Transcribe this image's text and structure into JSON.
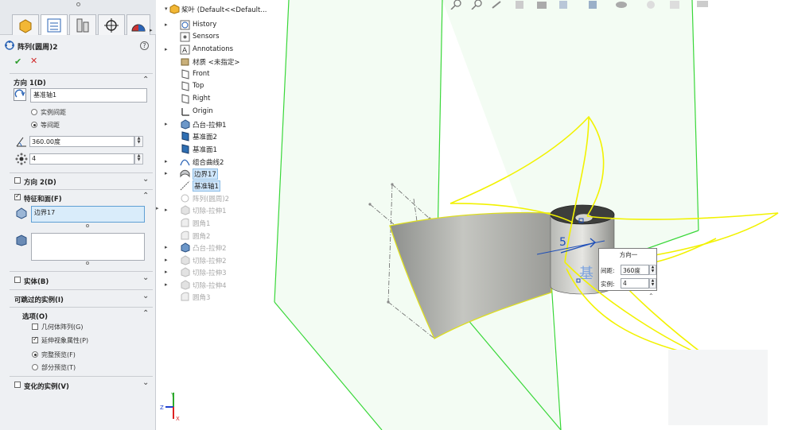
{
  "property_manager": {
    "title": "阵列(圆周)2",
    "help_icon": "question-mark-icon",
    "tabs": [
      "feature-manager-icon",
      "property-manager-icon",
      "configuration-manager-icon",
      "dimxpert-icon",
      "display-manager-icon"
    ],
    "direction1": {
      "label": "方向 1(D)",
      "axis_value": "基准轴1",
      "spacing_options": [
        {
          "label": "实例间距",
          "selected": false
        },
        {
          "label": "等间距",
          "selected": true
        }
      ],
      "angle_value": "360.00度",
      "instances_value": "4"
    },
    "direction2": {
      "label": "方向 2(D)",
      "checked": false
    },
    "features_faces": {
      "label": "特征和面(F)",
      "checked": true,
      "features_list": [
        "边界17"
      ],
      "faces_list": []
    },
    "bodies": {
      "label": "实体(B)",
      "checked": false
    },
    "skipped_instances": {
      "label": "可跳过的实例(I)"
    },
    "options": {
      "label": "选项(O)",
      "geometry_pattern": {
        "label": "几何体阵列(G)",
        "checked": false
      },
      "propagate_visual": {
        "label": "延伸视象属性(P)",
        "checked": true
      },
      "full_preview": {
        "label": "完整预览(F)",
        "selected": true
      },
      "partial_preview": {
        "label": "部分预览(T)",
        "selected": false
      }
    },
    "varying_instances": {
      "label": "变化的实例(V)",
      "checked": false
    }
  },
  "feature_tree": {
    "root": "桨叶  (Default<<Default...",
    "items": [
      {
        "label": "History",
        "icon": "history-icon",
        "expand": true,
        "state": "normal"
      },
      {
        "label": "Sensors",
        "icon": "sensors-icon",
        "expand": false,
        "state": "normal"
      },
      {
        "label": "Annotations",
        "icon": "annotations-icon",
        "expand": true,
        "state": "normal"
      },
      {
        "label": "材质 <未指定>",
        "icon": "material-icon",
        "expand": false,
        "state": "normal"
      },
      {
        "label": "Front",
        "icon": "plane-icon",
        "expand": false,
        "state": "normal"
      },
      {
        "label": "Top",
        "icon": "plane-icon",
        "expand": false,
        "state": "normal"
      },
      {
        "label": "Right",
        "icon": "plane-icon",
        "expand": false,
        "state": "normal"
      },
      {
        "label": "Origin",
        "icon": "origin-icon",
        "expand": false,
        "state": "normal"
      },
      {
        "label": "凸台-拉伸1",
        "icon": "boss-extrude-icon",
        "expand": true,
        "state": "normal"
      },
      {
        "label": "基准面2",
        "icon": "plane-solid-icon",
        "expand": false,
        "state": "normal"
      },
      {
        "label": "基准面1",
        "icon": "plane-solid-icon",
        "expand": false,
        "state": "normal"
      },
      {
        "label": "组合曲线2",
        "icon": "composite-curve-icon",
        "expand": true,
        "state": "normal"
      },
      {
        "label": "边界17",
        "icon": "boundary-icon",
        "expand": true,
        "state": "selected"
      },
      {
        "label": "基准轴1",
        "icon": "axis-icon",
        "expand": false,
        "state": "selected"
      },
      {
        "label": "阵列(圆周)2",
        "icon": "circular-pattern-icon",
        "expand": false,
        "state": "dim"
      },
      {
        "label": "切除-拉伸1",
        "icon": "cut-extrude-icon",
        "expand": true,
        "state": "dim"
      },
      {
        "label": "圆角1",
        "icon": "fillet-icon",
        "expand": false,
        "state": "dim"
      },
      {
        "label": "圆角2",
        "icon": "fillet-icon",
        "expand": false,
        "state": "dim"
      },
      {
        "label": "凸台-拉伸2",
        "icon": "boss-extrude-icon",
        "expand": true,
        "state": "dim"
      },
      {
        "label": "切除-拉伸2",
        "icon": "cut-extrude-icon",
        "expand": true,
        "state": "dim"
      },
      {
        "label": "切除-拉伸3",
        "icon": "cut-extrude-icon",
        "expand": true,
        "state": "dim"
      },
      {
        "label": "切除-拉伸4",
        "icon": "cut-extrude-icon",
        "expand": true,
        "state": "dim"
      },
      {
        "label": "圆角3",
        "icon": "fillet-icon",
        "expand": false,
        "state": "dim"
      }
    ]
  },
  "callout": {
    "title": "方向一",
    "spacing_label": "间距:",
    "spacing_value": "360度",
    "instances_label": "实例:",
    "instances_value": "4"
  },
  "viewport": {
    "axis_tag": "5",
    "axis_name_overlay": "基",
    "triad_labels": [
      "Y",
      "Z",
      "X"
    ]
  },
  "colors": {
    "plane_green": "#39d739",
    "preview_yellow": "#f2f200",
    "accent_blue": "#1f4fb8"
  }
}
